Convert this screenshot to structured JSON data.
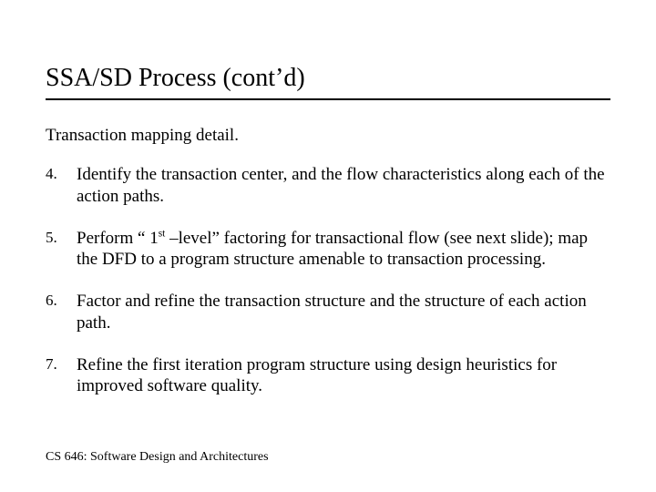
{
  "title": "SSA/SD Process (cont’d)",
  "subtitle": "Transaction mapping detail.",
  "items": [
    {
      "num": "4.",
      "text": "Identify the transaction center, and the flow characteristics along each of the action paths."
    },
    {
      "num": "5.",
      "text_pre": "Perform “ 1",
      "super": "st",
      "text_post": " –level” factoring for transactional flow (see next slide); map the DFD to a program structure amenable to transaction processing."
    },
    {
      "num": "6.",
      "text": "Factor and refine the transaction structure and the structure of each action path."
    },
    {
      "num": "7.",
      "text": "Refine the first iteration program structure using design heuristics for improved software quality."
    }
  ],
  "footer": "CS 646: Software Design and Architectures"
}
